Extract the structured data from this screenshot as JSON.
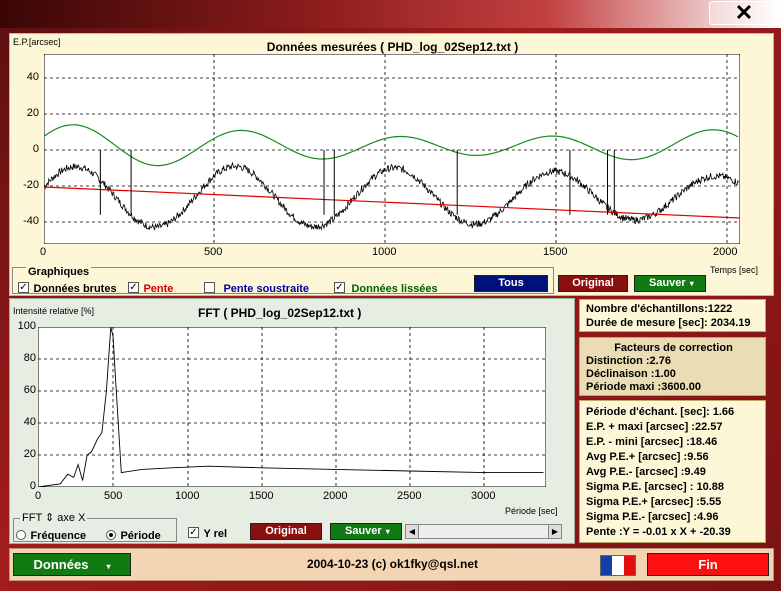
{
  "window": {
    "close_glyph": "✕"
  },
  "top_chart": {
    "y_unit": "E.P.[arcsec]",
    "title": "Données mesurées ( PHD_log_02Sep12.txt )",
    "x_unit": "Temps [sec]",
    "y_ticks": [
      "40",
      "20",
      "0",
      "-20",
      "-40"
    ],
    "x_ticks": [
      "0",
      "500",
      "1000",
      "1500",
      "2000"
    ]
  },
  "graphiques": {
    "label": "Graphiques",
    "options": [
      {
        "label": "Données brutes",
        "checked": true,
        "color": "#000000"
      },
      {
        "label": "Pente",
        "checked": true,
        "color": "#d40000"
      },
      {
        "label": "Pente soustraite",
        "checked": false,
        "color": "#0000a0"
      },
      {
        "label": "Données lissées",
        "checked": true,
        "color": "#006000"
      }
    ],
    "buttons": {
      "tous": "Tous",
      "original": "Original",
      "sauver": "Sauver"
    }
  },
  "fft_chart": {
    "y_unit": "Intensité relative [%]",
    "title": "FFT ( PHD_log_02Sep12.txt )",
    "x_unit": "Période [sec]",
    "y_ticks": [
      "100",
      "80",
      "60",
      "40",
      "20",
      "0"
    ],
    "x_ticks": [
      "0",
      "500",
      "1000",
      "1500",
      "2000",
      "2500",
      "3000"
    ]
  },
  "fft_axis": {
    "label": "FFT ⇕ axe X",
    "frequence": "Fréquence",
    "periode": "Période",
    "yrel": "Y rel",
    "original": "Original",
    "sauver": "Sauver"
  },
  "summary": {
    "samples": "Nombre d'échantillons:1222",
    "duration": "Durée de mesure [sec]: 2034.19"
  },
  "correction": {
    "title": "Facteurs de correction",
    "distinction": "Distinction :2.76",
    "declinaison": "Déclinaison :1.00",
    "periode_maxi": "Période maxi :3600.00"
  },
  "stats": [
    "Période d'échant. [sec]: 1.66",
    "E.P. + maxi [arcsec] :22.57",
    "E.P. - mini [arcsec] :18.46",
    "Avg P.E.+ [arcsec] :9.56",
    "Avg P.E.- [arcsec] :9.49",
    "Sigma P.E. [arcsec] : 10.88",
    "Sigma P.E.+ [arcsec] :5.55",
    "Sigma P.E.- [arcsec] :4.96",
    "Pente :Y = -0.01 x X + -20.39"
  ],
  "status": {
    "donnees": "Données",
    "credit": "2004-10-23 (c) ok1fky@qsl.net",
    "fin": "Fin"
  },
  "colors": {
    "raw": "#000000",
    "smoothed": "#1a8a1a",
    "slope": "#e00000",
    "blue_btn": "#00107a",
    "red_btn": "#8a1010",
    "green_btn": "#127a12"
  }
}
